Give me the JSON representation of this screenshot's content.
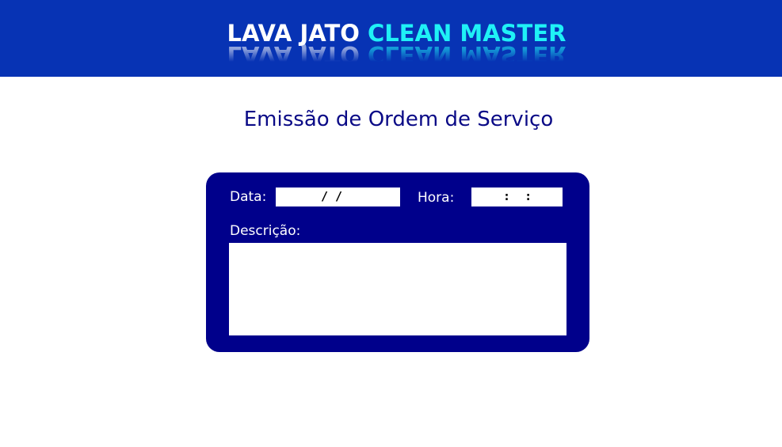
{
  "colors": {
    "header_bg": "#0733b4",
    "logo_white": "#ffffff",
    "logo_cyan": "#1ff1f6",
    "title_color": "#0a0a86",
    "panel_bg": "#00008b"
  },
  "header": {
    "logo_part1": "LAVA JATO ",
    "logo_part2": "CLEAN MASTER"
  },
  "page": {
    "title": "Emissão de Ordem de Serviço"
  },
  "form": {
    "date_label": "Data:",
    "date_value": "/ /",
    "time_label": "Hora:",
    "time_value": ":  :",
    "description_label": "Descrição:",
    "description_value": ""
  }
}
